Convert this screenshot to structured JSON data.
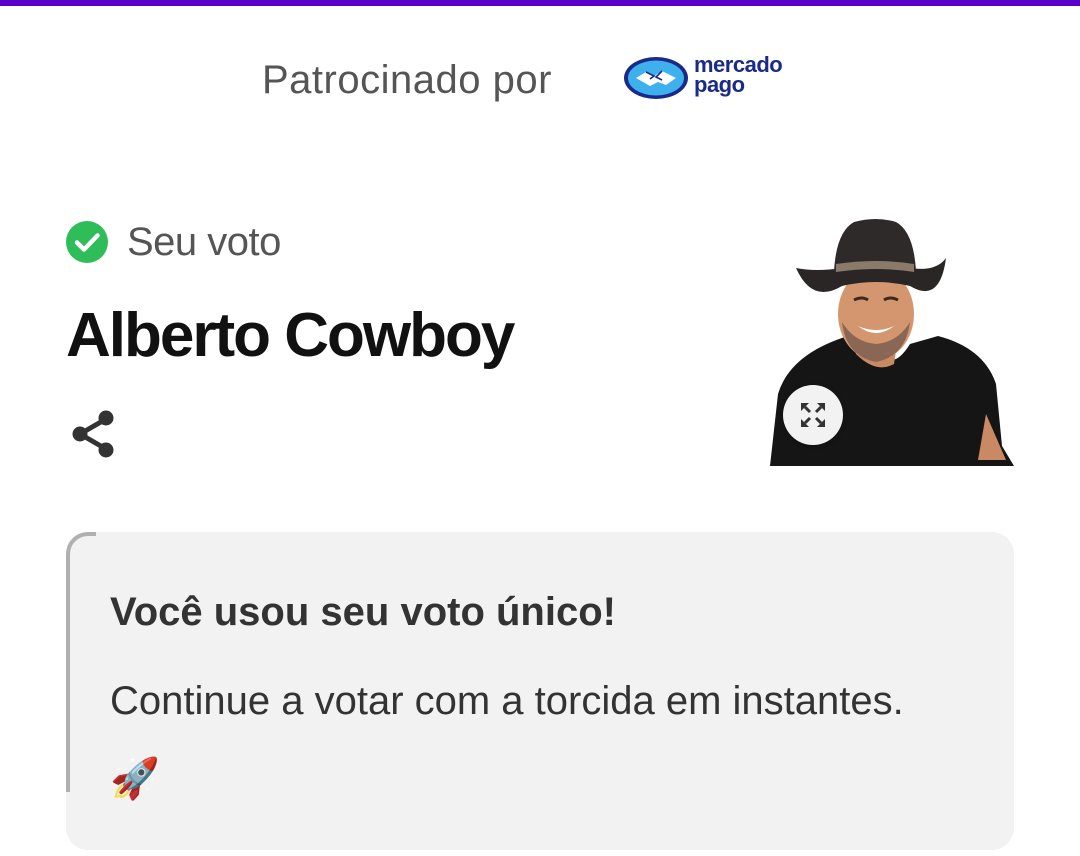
{
  "sponsor": {
    "label": "Patrocinado por",
    "brand_line1": "mercado",
    "brand_line2": "pago",
    "brand_color": "#1a2a8a",
    "brand_accent": "#3fb0ee"
  },
  "vote": {
    "status_label": "Seu voto",
    "status_icon": "check-circle-icon",
    "status_color": "#2ebd59",
    "candidate_name": "Alberto Cowboy",
    "share_icon": "share-icon",
    "expand_icon": "expand-icon"
  },
  "notice": {
    "title": "Você usou seu voto único!",
    "body": "Continue a votar com a torcida em instantes. 🚀"
  },
  "colors": {
    "top_bar": "#5a00c8",
    "notice_bg": "#f2f2f2"
  }
}
